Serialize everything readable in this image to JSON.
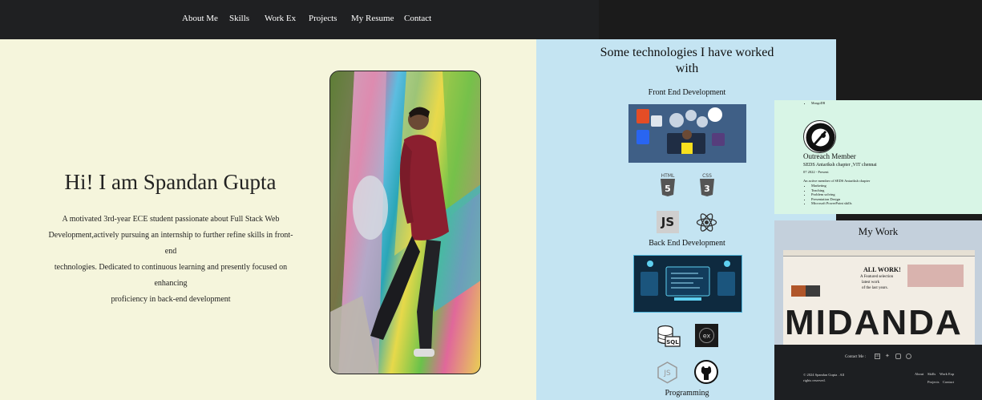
{
  "nav": {
    "items": [
      "About Me",
      "Skills",
      "Work Ex",
      "Projects",
      "My Resume",
      "Contact"
    ]
  },
  "hero": {
    "title": "Hi! I am Spandan Gupta",
    "description_lines": [
      "A motivated 3rd-year ECE student passionate about Full Stack Web",
      "Development,actively pursuing an internship to further refine skills in front-end",
      "technologies. Dedicated to continuous learning and presently focused on enhancing",
      "proficiency in back-end development"
    ]
  },
  "tech": {
    "title_line1": "Some technologies I have worked",
    "title_line2": "with",
    "front_end": "Front End Development",
    "back_end": "Back End Development",
    "programming": "Programming",
    "icons": [
      "html5-icon",
      "css3-icon",
      "javascript-icon",
      "react-icon",
      "sql-database-icon",
      "express-icon",
      "nodejs-icon",
      "github-icon"
    ],
    "html_label": "HTML",
    "css_label": "CSS",
    "js_label": "JS",
    "sql_label": "SQL",
    "express_label": "ex"
  },
  "resume": {
    "top_item": "MongoDB",
    "role": "Outreach Member",
    "org": "SEDS Antariksh chapter ,VIT chennai",
    "dates": "07 2022 - Present",
    "summary": "An active member of SEDS Antariksh chapter",
    "skills": [
      "Marketing",
      "Teaching",
      "Problem solving",
      "Presentation Design",
      "Microsoft PowerPoint skills"
    ]
  },
  "work": {
    "title": "My Work",
    "preview_heading": "ALL WORK!",
    "preview_sub1": "A Featured selection",
    "preview_sub2": "latest work",
    "preview_sub3": "of the last years.",
    "big_text": "MIDANDA"
  },
  "footer": {
    "contact_label": "Contact Me :",
    "copyright_line1": "© 2024 Spandan Gupta . All",
    "copyright_line2": "rights reserved.",
    "links": [
      "About",
      "Skills",
      "Work Exp",
      "Projects",
      "Contact"
    ]
  },
  "colors": {
    "nav_bg": "#1f2022",
    "hero_bg": "#f5f5dc",
    "tech_bg": "#c4e4f2",
    "resume_bg": "#d8f5e6",
    "work_bg": "#c4d0dc",
    "footer_bg": "#1d1f22"
  }
}
